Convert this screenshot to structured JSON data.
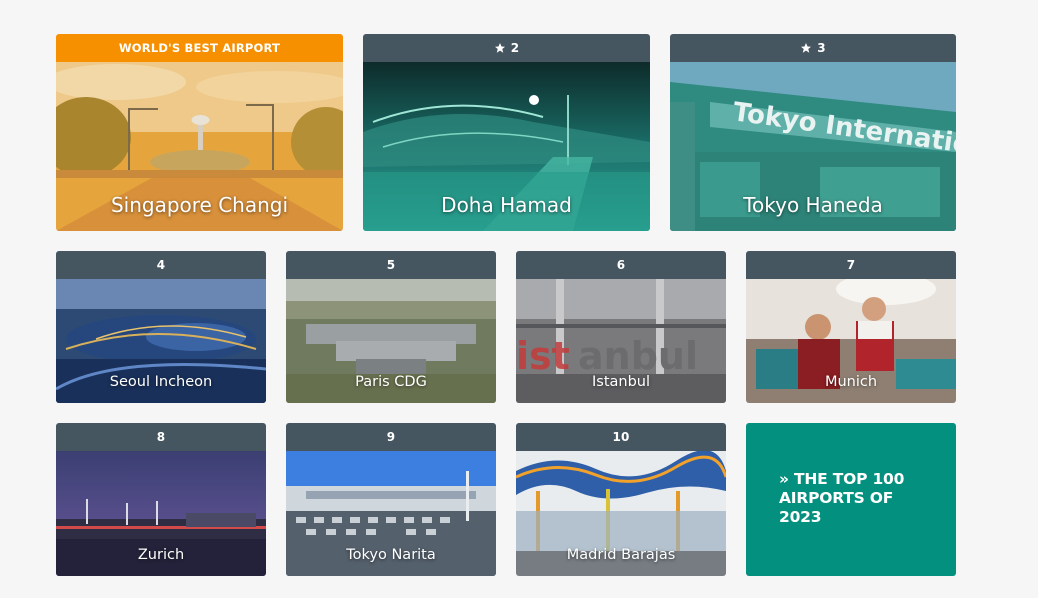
{
  "colors": {
    "header": "#455661",
    "best_header": "#f79000",
    "promo_bg": "#03907e",
    "page_bg": "#f6f6f7"
  },
  "featured": [
    {
      "rank_label": "WORLD'S BEST AIRPORT",
      "name": "Singapore Changi"
    },
    {
      "rank_label": "2",
      "name": "Doha Hamad",
      "icon": "star-icon"
    },
    {
      "rank_label": "3",
      "name": "Tokyo Haneda",
      "icon": "star-icon"
    }
  ],
  "grid": [
    {
      "rank_label": "4",
      "name": "Seoul Incheon"
    },
    {
      "rank_label": "5",
      "name": "Paris CDG"
    },
    {
      "rank_label": "6",
      "name": "Istanbul"
    },
    {
      "rank_label": "7",
      "name": "Munich"
    },
    {
      "rank_label": "8",
      "name": "Zurich"
    },
    {
      "rank_label": "9",
      "name": "Tokyo Narita"
    },
    {
      "rank_label": "10",
      "name": "Madrid Barajas"
    }
  ],
  "promo": {
    "line1": "» THE TOP 100",
    "line2": "AIRPORTS OF",
    "line3": "2023"
  }
}
